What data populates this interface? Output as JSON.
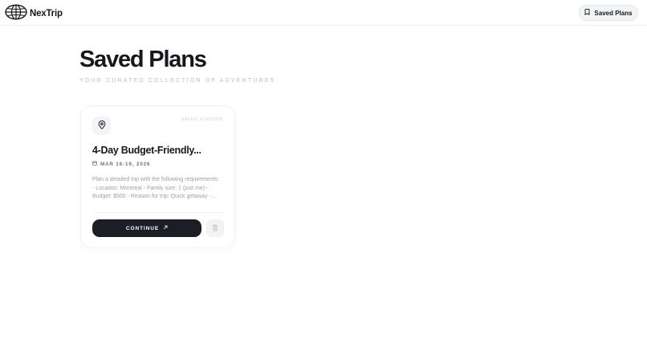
{
  "app": {
    "name": "NexTrip"
  },
  "header": {
    "saved_plans_label": "Saved Plans"
  },
  "page": {
    "title": "Saved Plans",
    "subtitle": "YOUR CURATED COLLECTION OF ADVENTURES."
  },
  "plans": [
    {
      "saved_label": "SAVED 3/16/2026",
      "title": "4-Day Budget-Friendly...",
      "dates": "MAR 16-19, 2026",
      "description": "Plan a detailed trip with the following requirements:\n- Location: Montreal - Family size: 1 (just me) -\nBudget: $500 - Reason for trip: Quick getaway -...",
      "continue_label": "CONTINUE"
    }
  ],
  "icons": {
    "logo": "globe-icon",
    "saved": "bookmark-icon",
    "pin": "map-pin-icon",
    "calendar": "calendar-icon",
    "arrow": "arrow-up-right-icon",
    "delete": "trash-icon"
  },
  "colors": {
    "primary_button": "#1b1e25",
    "muted_text": "#9ca0a8",
    "subtitle_text": "#b8bcc4"
  }
}
